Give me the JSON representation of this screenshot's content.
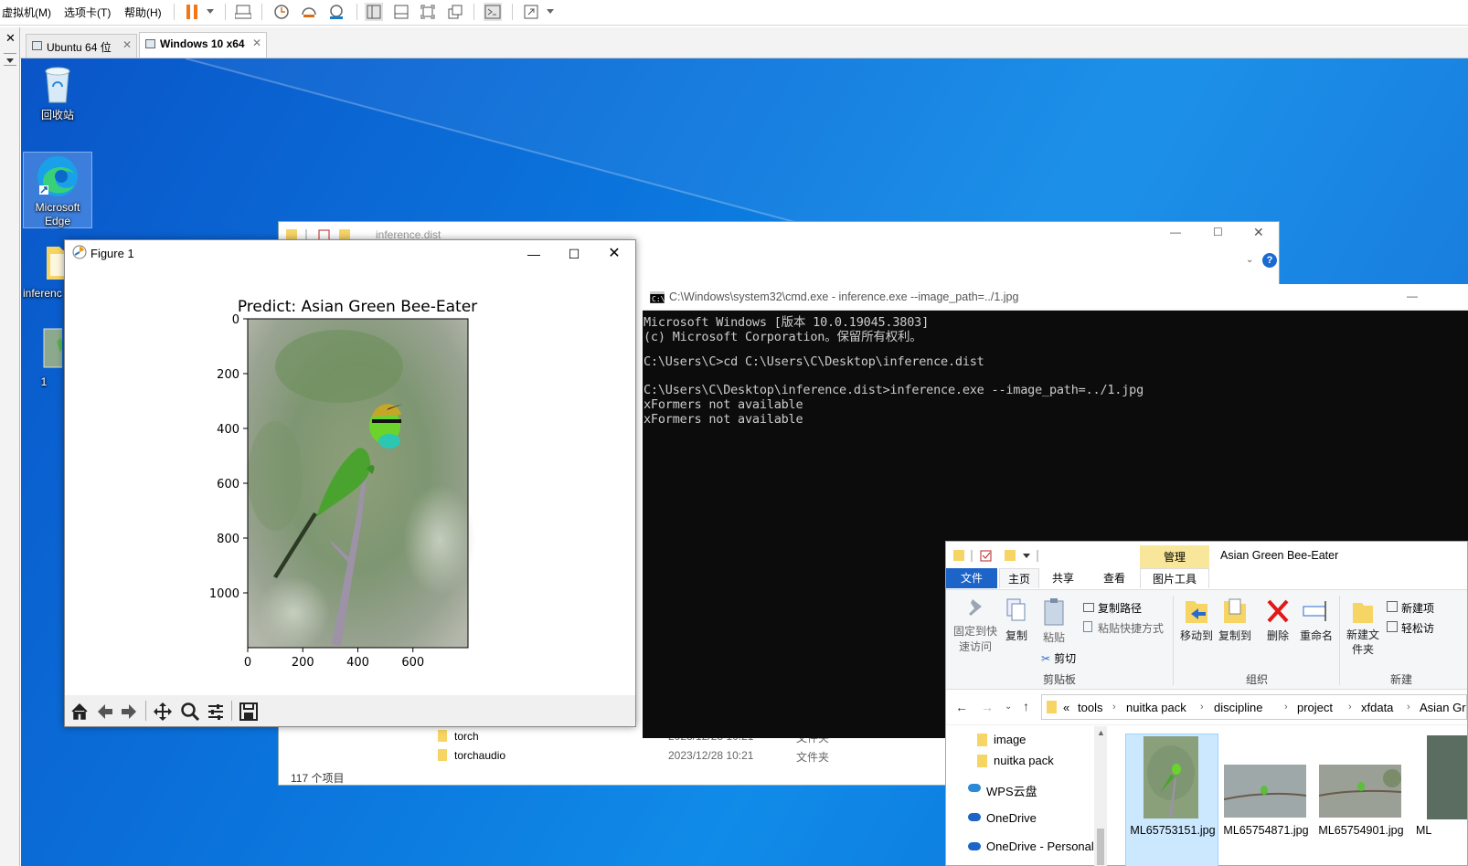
{
  "menubar": {
    "items": [
      "虚拟机(M)",
      "选项卡(T)",
      "帮助(H)"
    ]
  },
  "vm_tabs": [
    {
      "label": "Ubuntu 64 位",
      "active": false
    },
    {
      "label": "Windows 10 x64",
      "active": true
    }
  ],
  "desktop_icons": [
    {
      "label": "回收站",
      "icon": "recycle-bin-icon"
    },
    {
      "label": "Microsoft Edge",
      "icon": "edge-icon"
    },
    {
      "label": "inferenc",
      "icon": "folder-icon"
    },
    {
      "label": "1",
      "icon": "image-file-icon"
    }
  ],
  "explorer_back": {
    "title": "inference.dist",
    "files": [
      {
        "name": "torch",
        "date": "2023/12/28 10:21",
        "type": "文件夹"
      },
      {
        "name": "torchaudio",
        "date": "2023/12/28 10:21",
        "type": "文件夹"
      }
    ],
    "status": "117 个项目"
  },
  "figure": {
    "title": "Figure 1",
    "toolbar": [
      "home-icon",
      "back-arrow-icon",
      "forward-arrow-icon",
      "pan-icon",
      "zoom-icon",
      "configure-icon",
      "save-icon"
    ]
  },
  "chart_data": {
    "type": "image",
    "title": "Predict: Asian Green Bee-Eater",
    "xlim": [
      0,
      800
    ],
    "ylim": [
      1200,
      0
    ],
    "xticks": [
      "0",
      "200",
      "400",
      "600"
    ],
    "yticks": [
      "0",
      "200",
      "400",
      "600",
      "800",
      "1000"
    ]
  },
  "cmd": {
    "title": "C:\\Windows\\system32\\cmd.exe - inference.exe  --image_path=../1.jpg",
    "lines": [
      "Microsoft Windows [版本 10.0.19045.3803]",
      "(c) Microsoft Corporation。保留所有权利。",
      "",
      "C:\\Users\\C>cd C:\\Users\\C\\Desktop\\inference.dist",
      "",
      "C:\\Users\\C\\Desktop\\inference.dist>inference.exe --image_path=../1.jpg",
      "xFormers not available",
      "xFormers not available"
    ]
  },
  "explorer_front": {
    "title": "Asian Green Bee-Eater",
    "context_tab": "管理",
    "tabs": [
      "文件",
      "主页",
      "共享",
      "查看",
      "图片工具"
    ],
    "clipboard": {
      "pin": "固定到快速访问",
      "copy": "复制",
      "paste": "粘贴",
      "copy_path": "复制路径",
      "paste_shortcut": "粘贴快捷方式",
      "cut": "剪切",
      "group": "剪贴板"
    },
    "organize": {
      "move_to": "移动到",
      "copy_to": "复制到",
      "delete": "删除",
      "rename": "重命名",
      "group": "组织"
    },
    "new": {
      "new_folder": "新建文件夹",
      "new_item": "新建项",
      "easy_access": "轻松访",
      "group": "新建"
    },
    "breadcrumb": [
      "«",
      "tools",
      "nuitka pack",
      "discipline",
      "project",
      "xfdata",
      "Asian Gr"
    ],
    "nav_items": [
      {
        "label": "image",
        "icon": "folder-icon"
      },
      {
        "label": "nuitka pack",
        "icon": "folder-icon"
      },
      {
        "label": "WPS云盘",
        "icon": "cloud-icon"
      },
      {
        "label": "OneDrive",
        "icon": "onedrive-icon"
      },
      {
        "label": "OneDrive - Personal",
        "icon": "onedrive-icon"
      }
    ],
    "files": [
      "ML65753151.jpg",
      "ML65754871.jpg",
      "ML65754901.jpg",
      "ML"
    ]
  }
}
